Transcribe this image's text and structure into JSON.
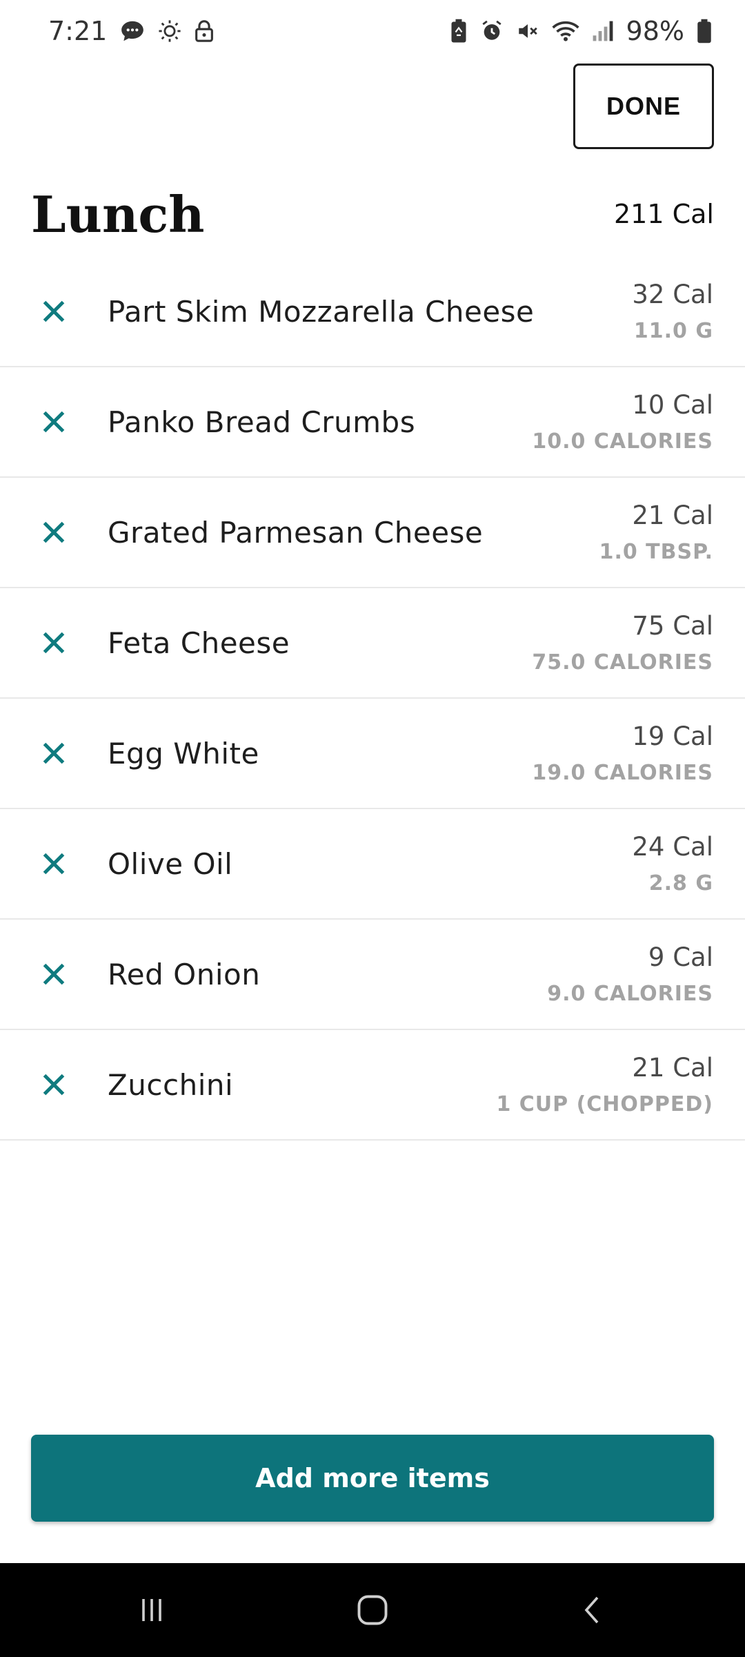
{
  "status_bar": {
    "time": "7:21",
    "battery": "98%"
  },
  "header": {
    "done_label": "DONE"
  },
  "meal": {
    "title": "Lunch",
    "total": "211 Cal"
  },
  "items": [
    {
      "name": "Part Skim Mozzarella Cheese",
      "calories": "32 Cal",
      "serving": "11.0 G"
    },
    {
      "name": "Panko Bread Crumbs",
      "calories": "10 Cal",
      "serving": "10.0 CALORIES"
    },
    {
      "name": "Grated Parmesan Cheese",
      "calories": "21 Cal",
      "serving": "1.0 TBSP."
    },
    {
      "name": "Feta Cheese",
      "calories": "75 Cal",
      "serving": "75.0 CALORIES"
    },
    {
      "name": "Egg White",
      "calories": "19 Cal",
      "serving": "19.0 CALORIES"
    },
    {
      "name": "Olive Oil",
      "calories": "24 Cal",
      "serving": "2.8 G"
    },
    {
      "name": "Red Onion",
      "calories": "9 Cal",
      "serving": "9.0 CALORIES"
    },
    {
      "name": "Zucchini",
      "calories": "21 Cal",
      "serving": "1 CUP (CHOPPED)"
    }
  ],
  "footer": {
    "add_label": "Add more items"
  },
  "colors": {
    "accent": "#0d747b",
    "remove_icon": "#0f7b7f"
  },
  "icons": {
    "status_left": [
      "chat-icon",
      "brightness-icon",
      "lock-icon"
    ],
    "status_right": [
      "battery-saver-icon",
      "alarm-icon",
      "mute-icon",
      "wifi-icon",
      "signal-icon",
      "battery-icon"
    ],
    "remove": "close-icon",
    "nav": [
      "recents-icon",
      "home-icon",
      "back-icon"
    ]
  }
}
